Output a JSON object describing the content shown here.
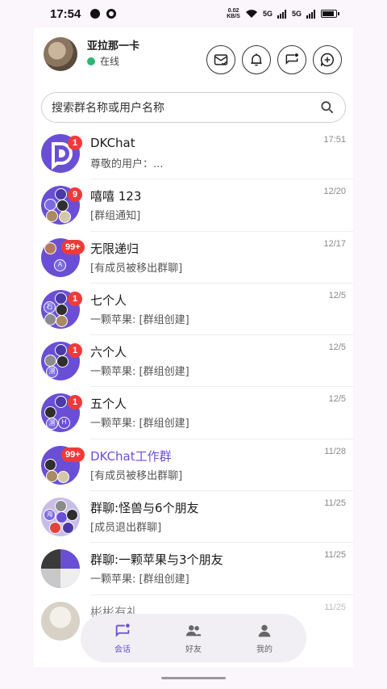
{
  "status_bar": {
    "time": "17:54",
    "speed_value": "0.02",
    "speed_unit": "KB/S",
    "net1": "5G",
    "net2": "5G",
    "battery_level": 0.85
  },
  "header": {
    "user_name": "亚拉那一卡",
    "status": "在线",
    "icons": [
      "mail-check-icon",
      "bell-icon",
      "chat-notify-icon",
      "chat-add-icon"
    ]
  },
  "search": {
    "placeholder": "搜索群名称或用户名称"
  },
  "chats": [
    {
      "title": "DKChat",
      "subtitle": "尊敬的用户：...",
      "time": "17:51",
      "badge": "1",
      "accent": false
    },
    {
      "title": "嘻嘻 123",
      "subtitle": "[群组通知]",
      "time": "12/20",
      "badge": "9",
      "accent": false
    },
    {
      "title": "无限递归",
      "subtitle": "[有成员被移出群聊]",
      "time": "12/17",
      "badge": "99+",
      "accent": false
    },
    {
      "title": "七个人",
      "subtitle": "一颗苹果: [群组创建]",
      "time": "12/5",
      "badge": "1",
      "accent": false
    },
    {
      "title": "六个人",
      "subtitle": "一颗苹果: [群组创建]",
      "time": "12/5",
      "badge": "1",
      "accent": false
    },
    {
      "title": "五个人",
      "subtitle": "一颗苹果: [群组创建]",
      "time": "12/5",
      "badge": "1",
      "accent": false
    },
    {
      "title": "DKChat工作群",
      "subtitle": "[有成员被移出群聊]",
      "time": "11/28",
      "badge": "99+",
      "accent": true
    },
    {
      "title": "群聊:怪兽与6个朋友",
      "subtitle": "[成员退出群聊]",
      "time": "11/25",
      "badge": "",
      "accent": false
    },
    {
      "title": "群聊:一颗苹果与3个朋友",
      "subtitle": "一颗苹果: [群组创建]",
      "time": "11/25",
      "badge": "",
      "accent": false
    },
    {
      "title": "彬彬有礼",
      "subtitle": "",
      "time": "11/25",
      "badge": "",
      "accent": false
    }
  ],
  "bottom_nav": [
    {
      "label": "会话",
      "icon": "chat-icon",
      "active": true
    },
    {
      "label": "好友",
      "icon": "friends-icon",
      "active": false
    },
    {
      "label": "我的",
      "icon": "profile-icon",
      "active": false
    }
  ],
  "colors": {
    "accent": "#6a4fd6",
    "badge": "#f03a3a",
    "online": "#2bb673"
  }
}
